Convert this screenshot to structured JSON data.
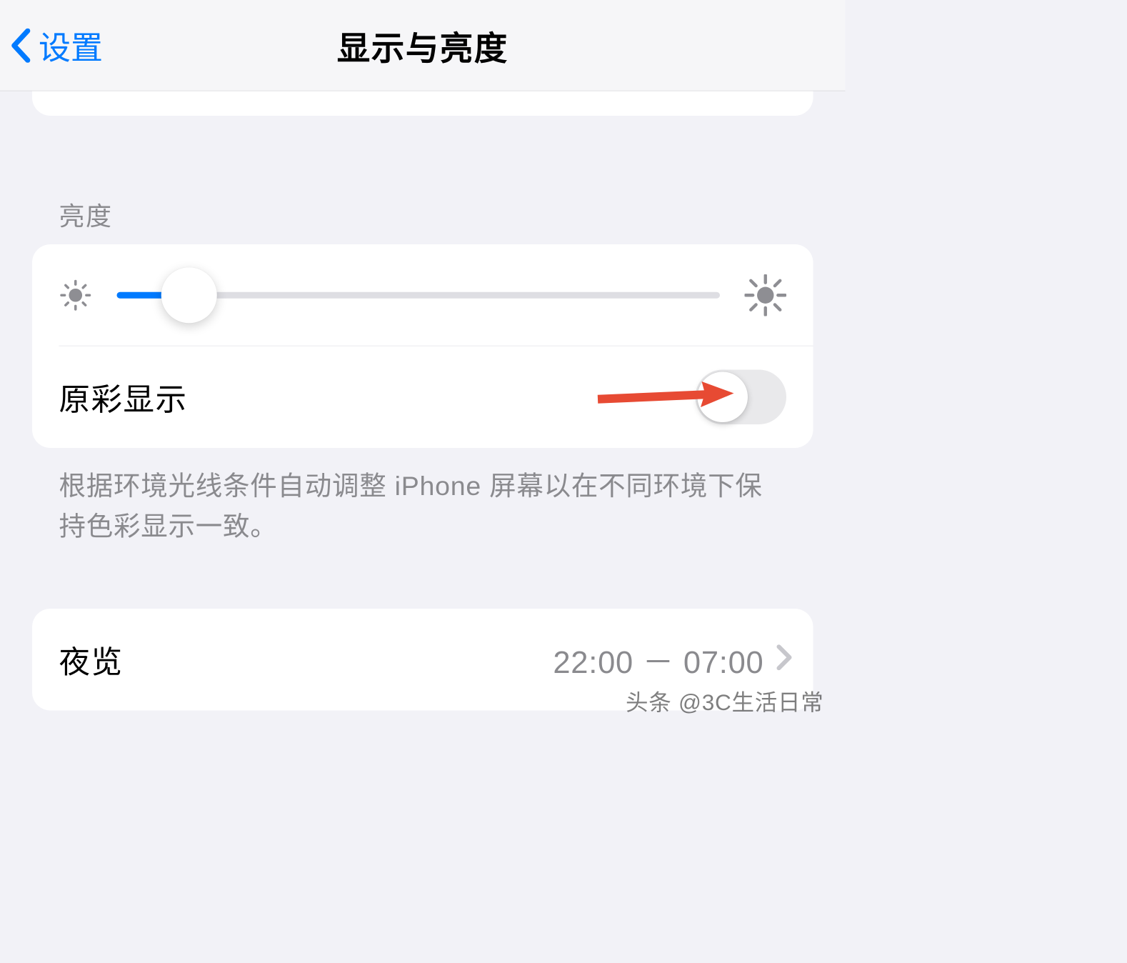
{
  "nav": {
    "back_label": "设置",
    "title": "显示与亮度"
  },
  "brightness": {
    "section_label": "亮度",
    "slider_value_percent": 12,
    "true_tone_label": "原彩显示",
    "true_tone_on": false,
    "footer": "根据环境光线条件自动调整 iPhone 屏幕以在不同环境下保持色彩显示一致。"
  },
  "night_shift": {
    "label": "夜览",
    "value": "22:00 － 07:00"
  },
  "watermark": "头条 @3C生活日常"
}
